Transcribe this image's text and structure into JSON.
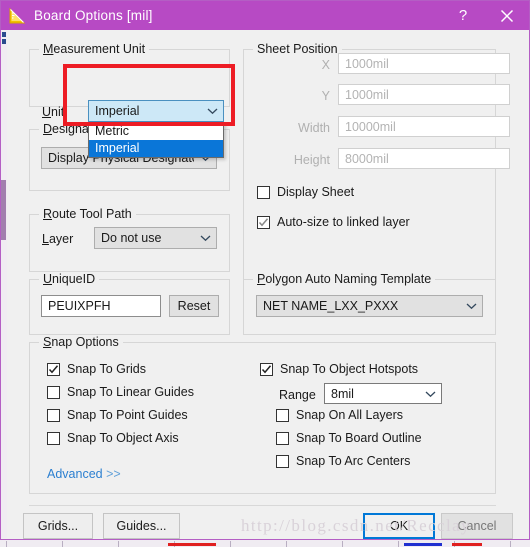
{
  "window": {
    "title": "Board Options [mil]",
    "icon": "ruler-triangle-icon",
    "help_label": "?",
    "close_label": "close-icon",
    "titlebar_color": "#b74ac4"
  },
  "measurement_unit": {
    "legend_prefix": "M",
    "legend_rest": "easurement Unit",
    "unit_label_prefix": "U",
    "unit_label_rest": "nit",
    "unit_value": "Imperial",
    "options": [
      {
        "label": "Metric",
        "selected": false
      },
      {
        "label": "Imperial",
        "selected": true
      }
    ],
    "dropdown_open": true
  },
  "designator_display": {
    "legend_prefix": "D",
    "legend_rest": "esignator Display",
    "value": "Display Physical Designators"
  },
  "route_tool_path": {
    "legend_prefix": "R",
    "legend_rest": "oute Tool Path",
    "layer_label_prefix": "L",
    "layer_label_rest": "ayer",
    "layer_value": "Do not use"
  },
  "unique_id": {
    "legend_prefix": "U",
    "legend_rest": "niqueID",
    "value": "PEUIXPFH",
    "reset_label": "Reset"
  },
  "sheet_position": {
    "legend": "Sheet Position",
    "fields": [
      {
        "label": "X",
        "value": "1000mil",
        "disabled": true
      },
      {
        "label": "Y",
        "value": "1000mil",
        "disabled": true
      },
      {
        "label": "Width",
        "value": "10000mil",
        "disabled": true
      },
      {
        "label": "Height",
        "value": "8000mil",
        "disabled": true
      }
    ],
    "display_sheet": {
      "label": "Display Sheet",
      "checked": false,
      "disabled": false
    },
    "auto_size": {
      "label": "Auto-size to linked layer",
      "checked": true,
      "disabled": true
    }
  },
  "polygon_naming": {
    "legend_prefix": "P",
    "legend_rest": "olygon Auto Naming Template",
    "value": "NET NAME_LXX_PXXX"
  },
  "snap_options": {
    "legend_prefix": "S",
    "legend_rest": "nap Options",
    "left_column": [
      {
        "label": "Snap To Grids",
        "checked": true
      },
      {
        "label": "Snap To Linear Guides",
        "checked": false
      },
      {
        "label": "Snap To Point Guides",
        "checked": false
      },
      {
        "label": "Snap To Object Axis",
        "checked": false
      }
    ],
    "hotspots": {
      "label": "Snap To Object Hotspots",
      "checked": true
    },
    "range_label": "Range",
    "range_value": "8mil",
    "right_column": [
      {
        "label": "Snap On All Layers",
        "checked": false
      },
      {
        "label": "Snap To Board Outline",
        "checked": false
      },
      {
        "label": "Snap To Arc Centers",
        "checked": false
      }
    ],
    "advanced_label": "Advanced",
    "advanced_arrows": ">>"
  },
  "footer": {
    "grids_label": "Grids...",
    "guides_label": "Guides...",
    "ok_label": "OK",
    "cancel_label": "Cancel"
  },
  "watermark": {
    "text": "http://blog.csdn.net/Recclay"
  }
}
